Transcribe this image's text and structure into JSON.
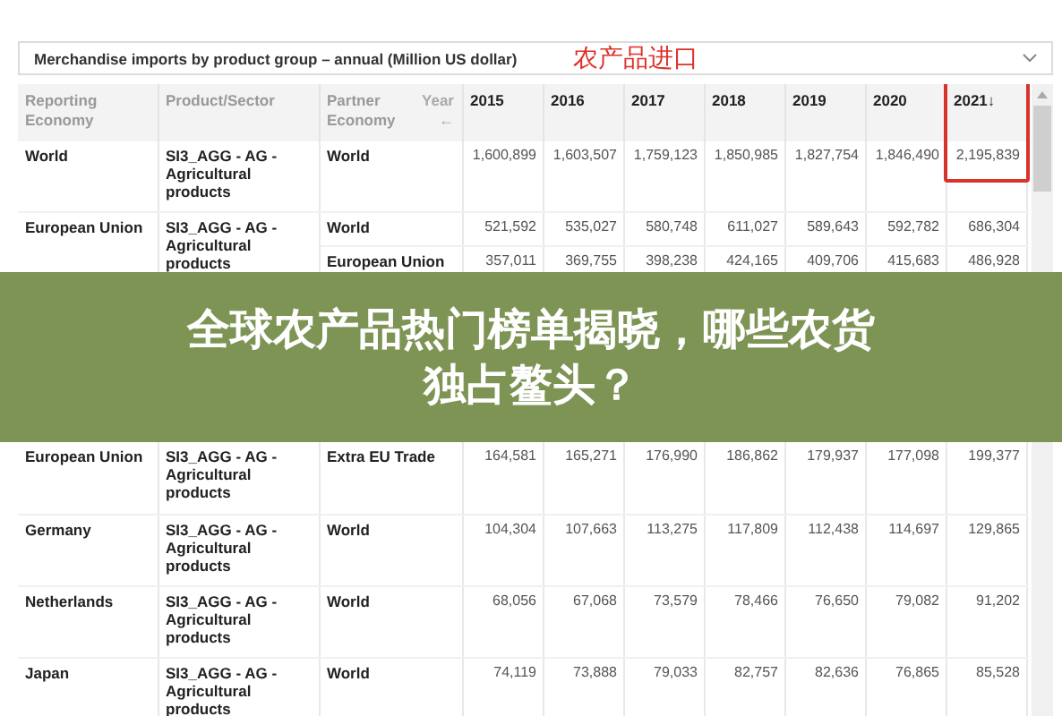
{
  "dropdown": {
    "value": "Merchandise imports by product group – annual (Million US dollar)"
  },
  "annotation": {
    "label": "农产品进口"
  },
  "table": {
    "columns": [
      "Reporting Economy",
      "Product/Sector",
      "Partner Economy"
    ],
    "year_label": "Year",
    "year_arrow": "←",
    "years": [
      {
        "label": "2015"
      },
      {
        "label": "2016"
      },
      {
        "label": "2017"
      },
      {
        "label": "2018"
      },
      {
        "label": "2019"
      },
      {
        "label": "2020"
      },
      {
        "label": "2021",
        "sort": "↓",
        "highlighted": true
      }
    ],
    "rows": [
      {
        "economy": "World",
        "product": "SI3_AGG - AG - Agricultural products",
        "partners": [
          {
            "partner": "World",
            "values": [
              "1,600,899",
              "1,603,507",
              "1,759,123",
              "1,850,985",
              "1,827,754",
              "1,846,490",
              "2,195,839"
            ]
          }
        ]
      },
      {
        "economy": "European Union",
        "product": "SI3_AGG - AG - Agricultural products",
        "partners": [
          {
            "partner": "World",
            "values": [
              "521,592",
              "535,027",
              "580,748",
              "611,027",
              "589,643",
              "592,782",
              "686,304"
            ]
          },
          {
            "partner": "European Union",
            "values": [
              "357,011",
              "369,755",
              "398,238",
              "424,165",
              "409,706",
              "415,683",
              "486,928"
            ]
          }
        ]
      }
    ]
  },
  "banner": {
    "lines": [
      "全球农产品热门榜单揭晓，哪些农货",
      "独占鳌头？"
    ]
  },
  "table_continued": {
    "rows": [
      {
        "economy": "European Union",
        "product": "SI3_AGG - AG - Agricultural products",
        "partners": [
          {
            "partner": "Extra EU Trade",
            "values": [
              "164,581",
              "165,271",
              "176,990",
              "186,862",
              "179,937",
              "177,098",
              "199,377"
            ]
          }
        ]
      },
      {
        "economy": "Germany",
        "product": "SI3_AGG - AG - Agricultural products",
        "partners": [
          {
            "partner": "World",
            "values": [
              "104,304",
              "107,663",
              "113,275",
              "117,809",
              "112,438",
              "114,697",
              "129,865"
            ]
          }
        ]
      },
      {
        "economy": "Netherlands",
        "product": "SI3_AGG - AG - Agricultural products",
        "partners": [
          {
            "partner": "World",
            "values": [
              "68,056",
              "67,068",
              "73,579",
              "78,466",
              "76,650",
              "79,082",
              "91,202"
            ]
          }
        ]
      },
      {
        "economy": "Japan",
        "product": "SI3_AGG - AG - Agricultural products",
        "partners": [
          {
            "partner": "World",
            "values": [
              "74,119",
              "73,888",
              "79,033",
              "82,757",
              "82,636",
              "76,865",
              "85,528"
            ]
          }
        ]
      }
    ]
  }
}
